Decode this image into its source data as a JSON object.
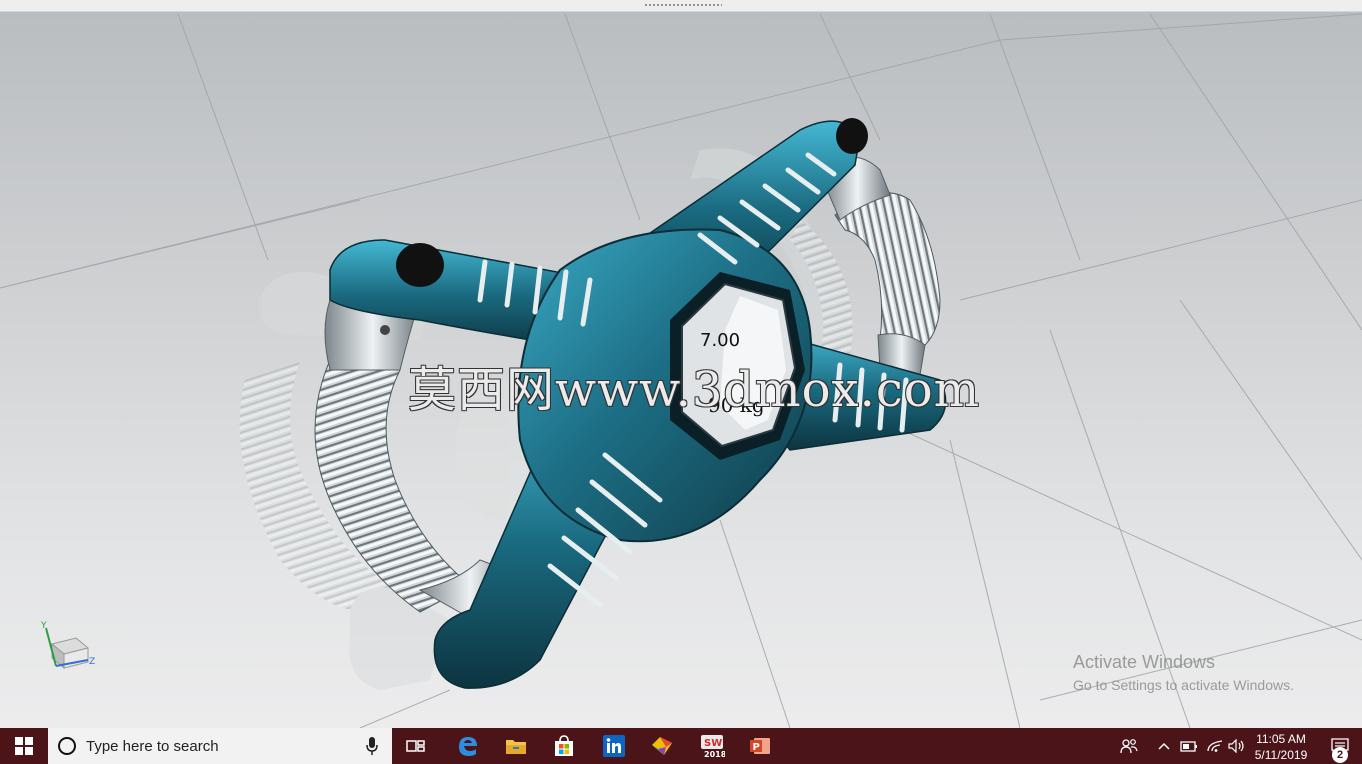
{
  "viewport": {
    "watermark": "莫西网www.3dmox.com",
    "model_label_top": "7.00",
    "model_label_bottom": "90 kg",
    "triad": {
      "y": "Y",
      "z": "Z"
    }
  },
  "activation": {
    "title": "Activate Windows",
    "subtitle": "Go to Settings to activate Windows."
  },
  "taskbar": {
    "search_placeholder": "Type here to search",
    "apps": [
      "task-view",
      "edge",
      "file-explorer",
      "store",
      "linkedin",
      "paint-3d",
      "solidworks-2018",
      "powerpoint"
    ],
    "solidworks_caption": "2018",
    "clock_time": "11:05 AM",
    "clock_date": "5/11/2019",
    "notification_count": "2"
  },
  "colors": {
    "taskbar": "#4a1418",
    "model_teal": "#1d6f86",
    "model_dark": "#0f3b47",
    "spring_silver": "#c9cfd3"
  }
}
